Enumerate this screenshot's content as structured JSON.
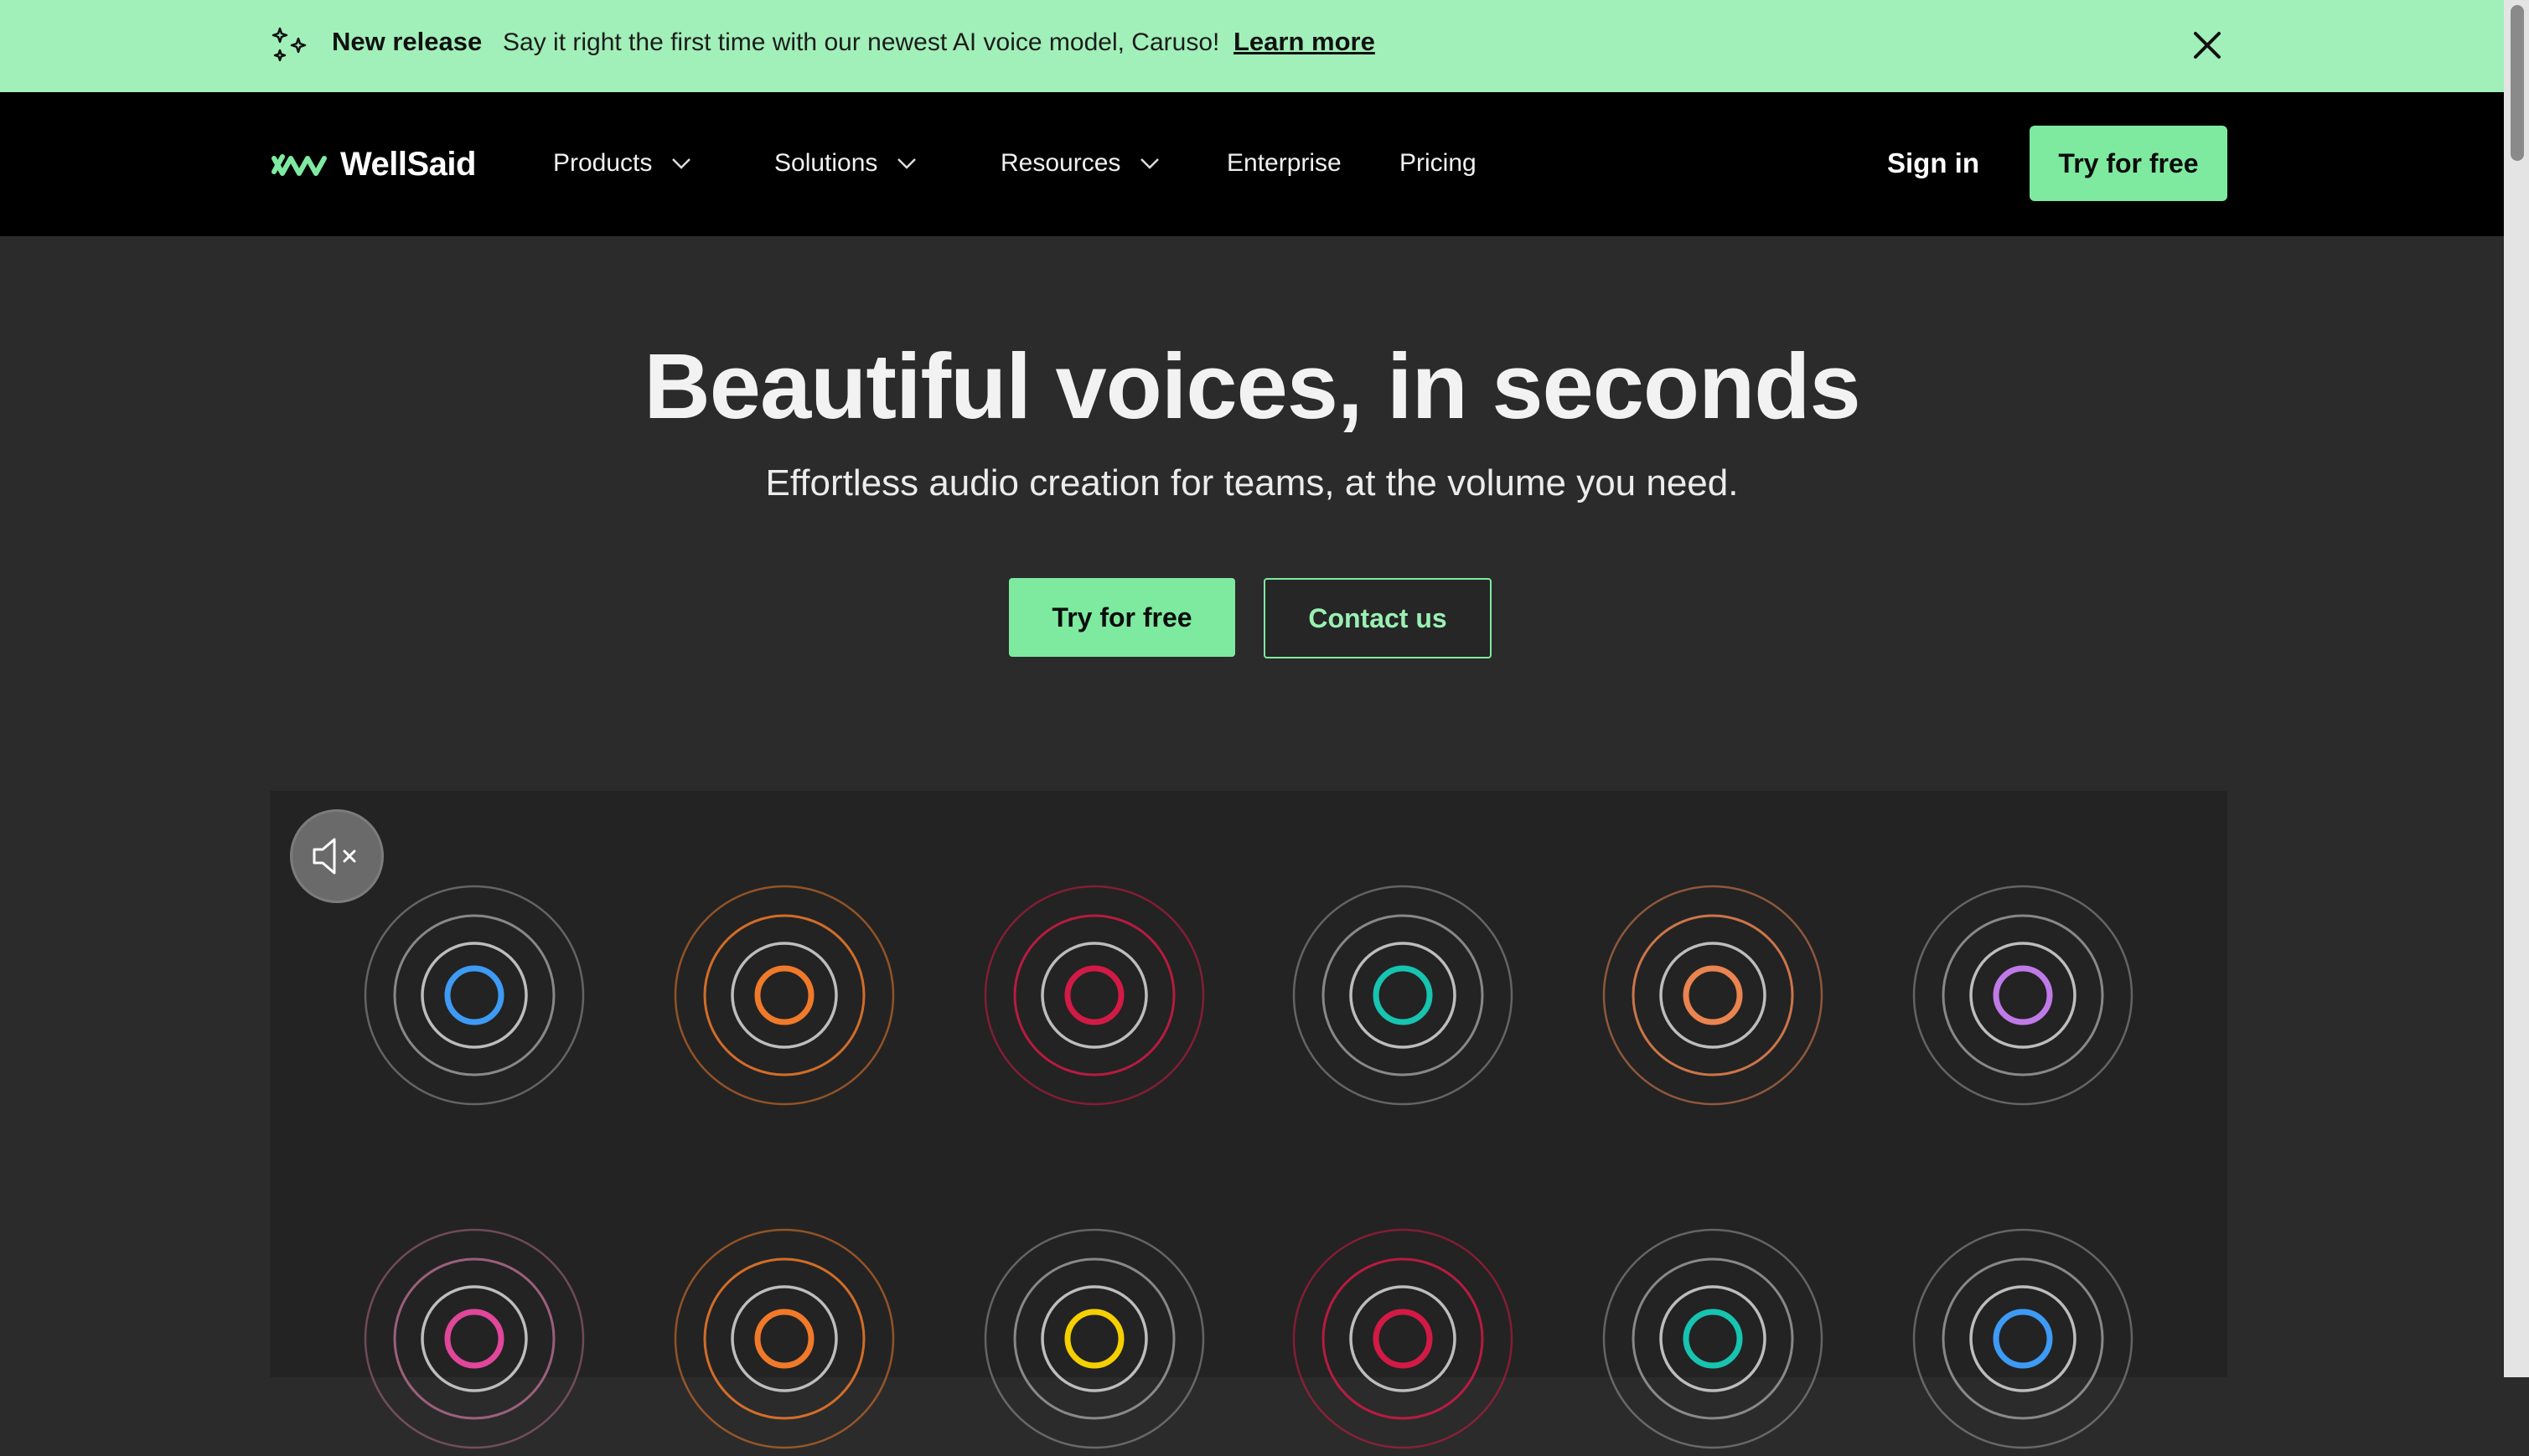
{
  "announcement": {
    "title": "New release",
    "message": "Say it right the first time with our newest AI voice model, Caruso!",
    "link": "Learn more",
    "bg_color": "#a1f0b9"
  },
  "nav": {
    "brand": "WellSaid",
    "items": [
      {
        "label": "Products",
        "dropdown": true
      },
      {
        "label": "Solutions",
        "dropdown": true
      },
      {
        "label": "Resources",
        "dropdown": true
      },
      {
        "label": "Enterprise",
        "dropdown": false
      },
      {
        "label": "Pricing",
        "dropdown": false
      }
    ],
    "sign_in": "Sign in",
    "try_free": "Try for free"
  },
  "hero": {
    "title": "Beautiful voices, in seconds",
    "subtitle": "Effortless audio creation for teams, at the volume you need.",
    "primary_cta": "Try for free",
    "secondary_cta": "Contact us"
  },
  "theme": {
    "accent": "#7eeaa0",
    "background": "#2b2b2b",
    "panel": "#232323"
  },
  "voice_grid": {
    "mute_icon": "speaker-muted-icon",
    "voices": [
      {
        "color": "#3d9bf5",
        "ring": "#9a9a9a"
      },
      {
        "color": "#f07a2a",
        "ring": "#f07a2a"
      },
      {
        "color": "#d11a45",
        "ring": "#d11a45"
      },
      {
        "color": "#17c4b0",
        "ring": "#9a9a9a"
      },
      {
        "color": "#ea8450",
        "ring": "#ea8450"
      },
      {
        "color": "#c07ae8",
        "ring": "#9a9a9a"
      },
      {
        "color": "#e0479a",
        "ring": "#b06a8a"
      },
      {
        "color": "#f07a2a",
        "ring": "#f07a2a"
      },
      {
        "color": "#f5d000",
        "ring": "#9a9a9a"
      },
      {
        "color": "#d11a45",
        "ring": "#d11a45"
      },
      {
        "color": "#17c4b0",
        "ring": "#9a9a9a"
      },
      {
        "color": "#3d9bf5",
        "ring": "#9a9a9a"
      }
    ]
  }
}
